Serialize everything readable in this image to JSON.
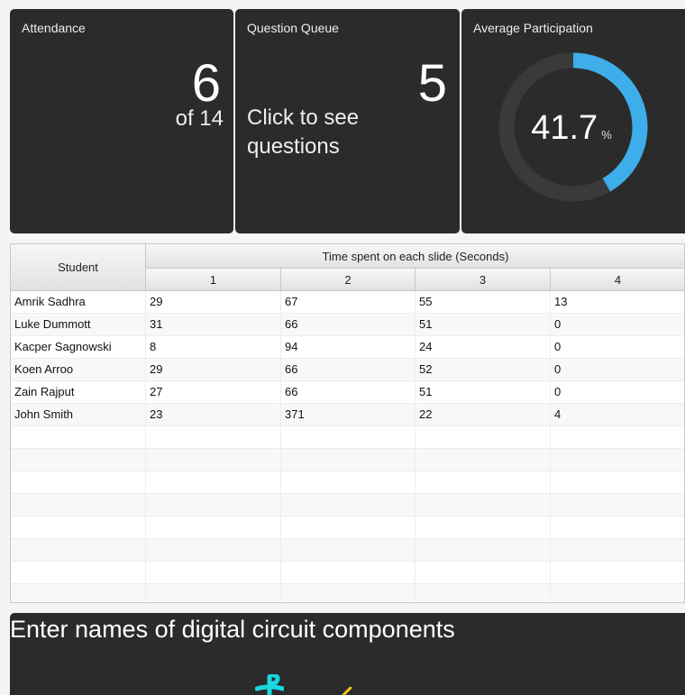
{
  "tiles": {
    "attendance": {
      "title": "Attendance",
      "present": "6",
      "of_label": "of 14"
    },
    "question_queue": {
      "title": "Question Queue",
      "count": "5",
      "link_line1": "Click to see",
      "link_line2": "questions"
    },
    "avg_participation": {
      "title": "Average Participation",
      "value": "41.7",
      "unit": "%",
      "fraction": 0.417,
      "arc_color": "#3daee9",
      "track_color": "#3a3a3a"
    }
  },
  "table": {
    "student_header": "Student",
    "group_header": "Time spent on each slide (Seconds)",
    "slide_headers": [
      "1",
      "2",
      "3",
      "4"
    ],
    "rows": [
      [
        "Amrik Sadhra",
        "29",
        "67",
        "55",
        "13"
      ],
      [
        "Luke Dummott",
        "31",
        "66",
        "51",
        "0"
      ],
      [
        "Kacper Sagnowski",
        "8",
        "94",
        "24",
        "0"
      ],
      [
        "Koen Arroo",
        "29",
        "66",
        "52",
        "0"
      ],
      [
        "Zain Rajput",
        "27",
        "66",
        "51",
        "0"
      ],
      [
        "John Smith",
        "23",
        "371",
        "22",
        "4"
      ]
    ]
  },
  "bottom_panel": {
    "title": "Enter names of digital circuit components",
    "doodle_colors": [
      "#19d6e0",
      "#f5c518"
    ]
  }
}
